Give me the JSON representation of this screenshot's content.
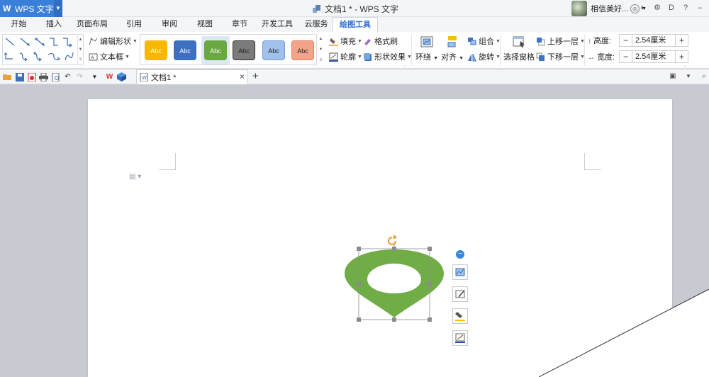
{
  "app": {
    "name": "WPS 文字",
    "window_title": "文档1 * - WPS 文字",
    "user_name": "相信美好..."
  },
  "tabs": [
    "开始",
    "插入",
    "页面布局",
    "引用",
    "审阅",
    "视图",
    "章节",
    "开发工具",
    "云服务",
    "绘图工具"
  ],
  "active_tab": "绘图工具",
  "ribbon": {
    "edit_shape": "编辑形状",
    "text_box": "文本框",
    "style_swatches": [
      {
        "label": "Abc",
        "fill": "#f8b800",
        "border": "#f8b800",
        "text": "#ffffff"
      },
      {
        "label": "Abc",
        "fill": "#3e6fc1",
        "border": "#3e6fc1",
        "text": "#ffffff"
      },
      {
        "label": "Abc",
        "fill": "#6aa842",
        "border": "#6aa842",
        "text": "#ffffff"
      },
      {
        "label": "Abc",
        "fill": "#7b7b7b",
        "border": "#333333",
        "text": "#222222"
      },
      {
        "label": "Abc",
        "fill": "#9fc1ec",
        "border": "#6f9fd6",
        "text": "#222222"
      },
      {
        "label": "Abc",
        "fill": "#f2a48a",
        "border": "#e0805f",
        "text": "#222222"
      }
    ],
    "selected_style": 2,
    "fill": "填充",
    "format_painter": "格式刷",
    "outline": "轮廓",
    "shape_effects": "形状效果",
    "wrap": "环绕",
    "align": "对齐",
    "group": "组合",
    "rotate": "旋转",
    "selection_pane": "选择窗格",
    "bring_forward": "上移一层",
    "send_backward": "下移一层",
    "height_label": "高度:",
    "height_value": "2.54厘米",
    "width_label": "宽度:",
    "width_value": "2.54厘米",
    "minus": "−",
    "plus": "+"
  },
  "doc_tab": {
    "name": "文档1 *",
    "close": "×",
    "new": "+"
  },
  "shape": {
    "fill": "#70ad47"
  },
  "colors": {
    "accent": "#3a7fd8",
    "active_tab_text": "#2d6fd0"
  }
}
